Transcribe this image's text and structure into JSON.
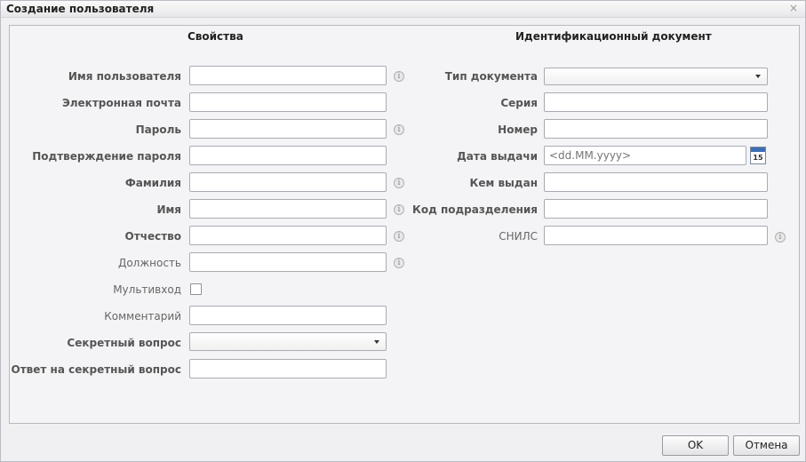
{
  "dialog": {
    "title": "Создание пользователя",
    "close": "×"
  },
  "properties": {
    "heading": "Свойства",
    "fields": [
      {
        "label": "Имя пользователя"
      },
      {
        "label": "Электронная почта"
      },
      {
        "label": "Пароль"
      },
      {
        "label": "Подтверждение пароля"
      },
      {
        "label": "Фамилия"
      },
      {
        "label": "Имя"
      },
      {
        "label": "Отчество"
      },
      {
        "label": "Должность"
      },
      {
        "label": "Мультивход"
      },
      {
        "label": "Комментарий"
      },
      {
        "label": "Секретный вопрос"
      },
      {
        "label": "Ответ на секретный вопрос"
      }
    ]
  },
  "document": {
    "heading": "Идентификационный документ",
    "fields": [
      {
        "label": "Тип документа"
      },
      {
        "label": "Серия"
      },
      {
        "label": "Номер"
      },
      {
        "label": "Дата выдачи",
        "placeholder": "<dd.MM.yyyy>"
      },
      {
        "label": "Кем выдан"
      },
      {
        "label": "Код подразделения"
      },
      {
        "label": "СНИЛС"
      }
    ],
    "calendar_day": "15"
  },
  "info_glyph": "i",
  "buttons": {
    "ok": "OK",
    "cancel": "Отмена"
  }
}
